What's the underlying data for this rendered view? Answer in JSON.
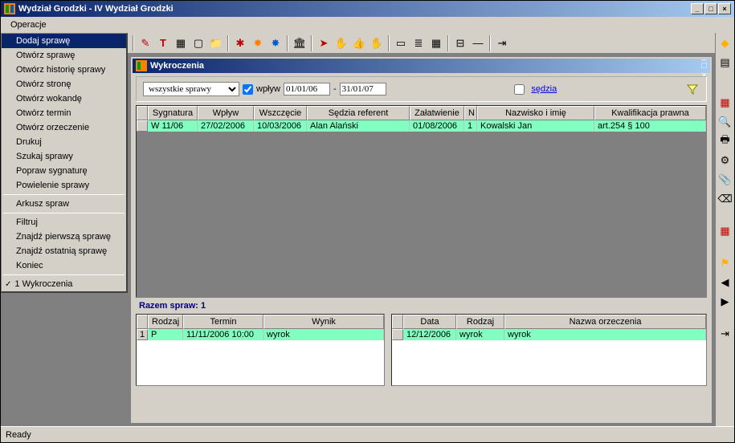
{
  "window": {
    "title": "Wydział Grodzki - IV Wydział Grodzki"
  },
  "menubar": {
    "operacje": "Operacje"
  },
  "dropdown": {
    "items": [
      "Dodaj sprawę",
      "Otwórz sprawę",
      "Otwórz historię sprawy",
      "Otwórz stronę",
      "Otwórz wokandę",
      "Otwórz termin",
      "Otwórz orzeczenie",
      "Drukuj",
      "Szukaj sprawy",
      "Popraw sygnaturę",
      "Powielenie sprawy"
    ],
    "arkusz": "Arkusz spraw",
    "group3": [
      "Filtruj",
      "Znajdź pierwszą sprawę",
      "Znajdź ostatnią sprawę",
      "Koniec"
    ],
    "checked": "1 Wykroczenia"
  },
  "child": {
    "title": "Wykroczenia"
  },
  "filter": {
    "select": "wszystkie sprawy",
    "wplyw_label": "wpływ",
    "date_from": "01/01/06",
    "date_to": "31/01/07",
    "sedzia": "sędzia"
  },
  "main_grid": {
    "headers": [
      "Sygnatura",
      "Wpływ",
      "Wszczęcie",
      "Sędzia referent",
      "Załatwienie",
      "N",
      "Nazwisko i imię",
      "Kwalifikacja prawna"
    ],
    "row": {
      "sygnatura": "W  11/06",
      "wplyw": "27/02/2006",
      "wszczecie": "10/03/2006",
      "sedzia": "Alan Alański",
      "zalatwienie": "01/08/2006",
      "n": "1",
      "nazwisko": "Kowalski Jan",
      "kwalifikacja": "art.254 § 100"
    }
  },
  "summary": "Razem spraw: 1",
  "left_grid": {
    "headers": [
      "Rodzaj",
      "Termin",
      "Wynik"
    ],
    "row": {
      "num": "1",
      "rodzaj": "P",
      "termin": "11/11/2006  10:00",
      "wynik": "wyrok"
    }
  },
  "right_grid": {
    "headers": [
      "Data",
      "Rodzaj",
      "Nazwa orzeczenia"
    ],
    "row": {
      "data": "12/12/2006",
      "rodzaj": "wyrok",
      "nazwa": "wyrok"
    }
  },
  "status": "Ready",
  "icons": {
    "pencil": "✎",
    "t": "T",
    "doc": "▢",
    "folder": "📁",
    "bug": "✱",
    "star": "✸",
    "hand": "✋",
    "building": "🏛",
    "arrow": "➤",
    "glove": "👍",
    "palm": "✋",
    "card": "▭",
    "list": "≣",
    "grid": "▦",
    "equals": "⊟",
    "line": "—",
    "exit": "⇥",
    "min": "_",
    "max": "□",
    "close": "×",
    "diamond": "◆",
    "book": "▤",
    "gear": "⚙",
    "search": "🔍",
    "print": "🖶",
    "clip": "📎",
    "erase": "⌫",
    "calendar": "▦",
    "flag": "⚑",
    "left": "◀",
    "right": "▶",
    "funnel": "▼"
  }
}
